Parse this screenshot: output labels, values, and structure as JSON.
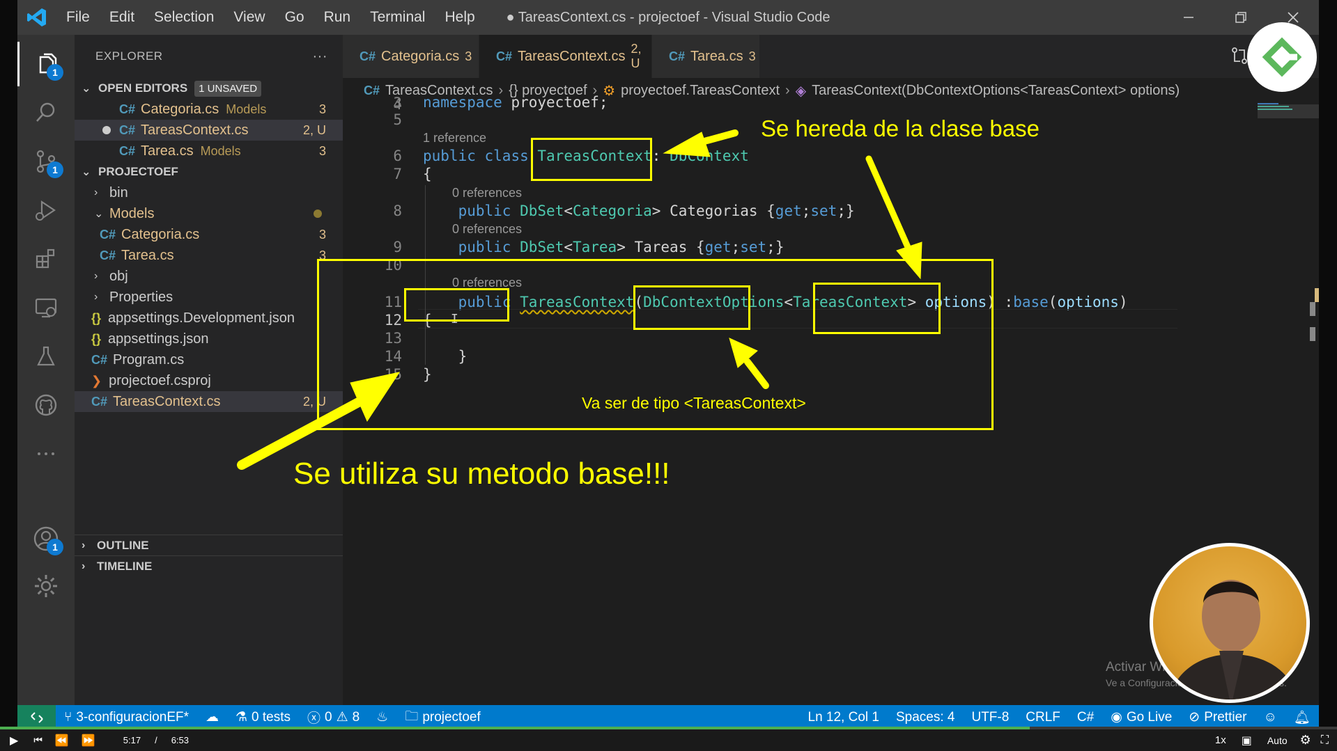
{
  "titlebar": {
    "menu": [
      "File",
      "Edit",
      "Selection",
      "View",
      "Go",
      "Run",
      "Terminal",
      "Help"
    ],
    "title": "● TareasContext.cs - projectoef - Visual Studio Code"
  },
  "activity": {
    "explorer_badge": "1",
    "scm_badge": "1",
    "account_badge": "1"
  },
  "sidebar": {
    "title": "EXPLORER",
    "more": "···",
    "open_editors": {
      "label": "OPEN EDITORS",
      "badge": "1 UNSAVED"
    },
    "open_files": [
      {
        "name": "Categoria.cs",
        "folder": "Models",
        "status": "3"
      },
      {
        "name": "TareasContext.cs",
        "folder": "",
        "status": "2, U"
      },
      {
        "name": "Tarea.cs",
        "folder": "Models",
        "status": "3"
      }
    ],
    "project": {
      "label": "PROJECTOEF"
    },
    "tree": {
      "bin": "bin",
      "models": "Models",
      "categoria": {
        "name": "Categoria.cs",
        "status": "3"
      },
      "tarea": {
        "name": "Tarea.cs",
        "status": "3"
      },
      "obj": "obj",
      "properties": "Properties",
      "appsettings_dev": "appsettings.Development.json",
      "appsettings": "appsettings.json",
      "program": "Program.cs",
      "csproj": "projectoef.csproj",
      "tareascontext": {
        "name": "TareasContext.cs",
        "status": "2, U"
      }
    },
    "outline": "OUTLINE",
    "timeline": "TIMELINE"
  },
  "tabs": [
    {
      "name": "Categoria.cs",
      "count": "3"
    },
    {
      "name": "TareasContext.cs",
      "count": "2, U"
    },
    {
      "name": "Tarea.cs",
      "count": "3"
    }
  ],
  "breadcrumb": [
    "TareasContext.cs",
    "{} proyectoef",
    "proyectoef.TareasContext",
    "TareasContext(DbContextOptions<TareasContext> options)"
  ],
  "editor": {
    "lines": [
      "4",
      "5",
      "6",
      "7",
      "8",
      "9",
      "10",
      "11",
      "12",
      "13",
      "14",
      "15"
    ],
    "lens": {
      "one_ref": "1 reference",
      "zero_ref": "0 references"
    },
    "code": {
      "ns_kw": "namespace",
      "ns_name": "proyectoef;",
      "pub": "public",
      "class_kw": "class",
      "class_name": "TareasContext",
      "colon": ":",
      "base_type": "DbContext",
      "open_brace": "{",
      "close_brace": "}",
      "dbset": "DbSet",
      "categoria": "Categoria",
      "categorias": "Categorias",
      "tarea": "Tarea",
      "tareas": "Tareas",
      "get": "get",
      "set": "set",
      "ctor_name": "TareasContext",
      "ctor_param_type": "DbContextOptions",
      "ctor_generic": "TareasContext",
      "options": "options",
      "base_kw": "base"
    }
  },
  "annotations": {
    "inherits": "Se hereda de la clase base",
    "type_note": "Va ser de tipo <TareasContext>",
    "base_method": "Se utiliza su metodo base!!!"
  },
  "status": {
    "branch": "3-configuracionEF*",
    "tests": "0 tests",
    "errors": "0",
    "warnings": "8",
    "folder": "projectoef",
    "position": "Ln 12, Col 1",
    "spaces": "Spaces: 4",
    "encoding": "UTF-8",
    "eol": "CRLF",
    "lang": "C#",
    "golive": "Go Live",
    "prettier": "Prettier"
  },
  "watermark": {
    "line1": "Activar Windows",
    "line2": "Ve a Configuración para activar Windows."
  },
  "player": {
    "current": "5:17",
    "sep": "/",
    "total": "6:53",
    "speed": "1x",
    "quality": "Auto",
    "progress": 0.77
  }
}
